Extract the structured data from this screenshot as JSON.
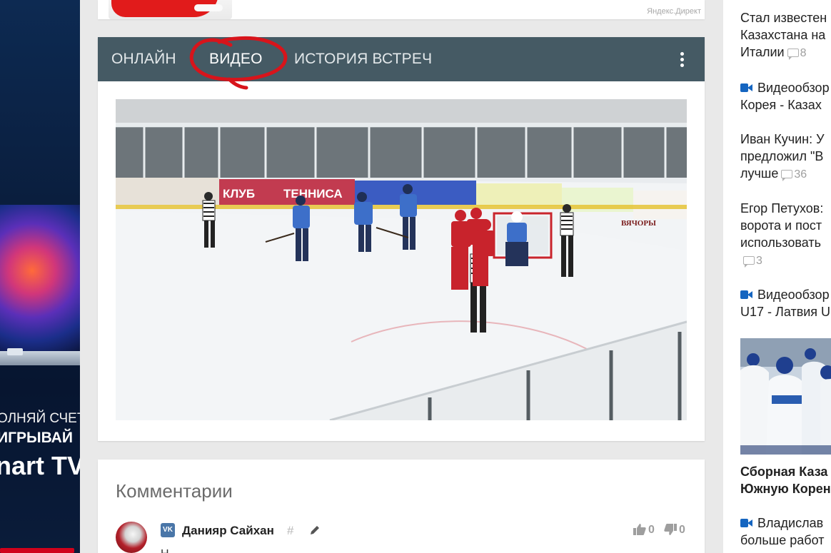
{
  "ad_left": {
    "line1": "ОЛНЯЙ СЧЕТ",
    "line2": "ИГРЫВАЙ",
    "line3": "nart TV"
  },
  "top_card": {
    "source_label": "Яндекс.Директ"
  },
  "video_card": {
    "tabs": [
      {
        "label": "ОНЛАЙН"
      },
      {
        "label": "ВИДЕО"
      },
      {
        "label": "ИСТОРИЯ ВСТРЕЧ"
      }
    ],
    "active_tab": "ВИДЕО",
    "video": {
      "board_text_1": "КЛУБ",
      "board_text_2": "ТЕННИСА",
      "board_text_3": "ВЯЧОРЫ"
    }
  },
  "comments": {
    "title": "Комментарии",
    "items": [
      {
        "author": "Данияр Сайхан",
        "network": "VK",
        "hash": "#",
        "likes": "0",
        "dislikes": "0",
        "text": "Н"
      }
    ]
  },
  "news": [
    {
      "title_lines": [
        "Стал известен",
        "Казахстана на",
        "Италии"
      ],
      "comments": "8",
      "video": false
    },
    {
      "title_lines": [
        "Видеообзор",
        "Корея - Казах"
      ],
      "comments": "",
      "video": true
    },
    {
      "title_lines": [
        "Иван Кучин: У",
        "предложил \"В",
        "лучше"
      ],
      "comments": "36",
      "video": false
    },
    {
      "title_lines": [
        "Егор Петухов:",
        "ворота и пост",
        "использовать"
      ],
      "comments": "3",
      "video": false
    },
    {
      "title_lines": [
        "Видеообзор",
        "U17 - Латвия U"
      ],
      "comments": "",
      "video": true
    },
    {
      "title_lines": [
        "Сборная Каза",
        "Южную Корен"
      ],
      "comments": "",
      "video": false
    },
    {
      "title_lines": [
        "Владислав",
        "больше работ"
      ],
      "comments": "",
      "video": true
    }
  ],
  "colors": {
    "tab_bar": "#455a64",
    "accent_blue": "#1565c0",
    "annotation_red": "#d8141b"
  }
}
